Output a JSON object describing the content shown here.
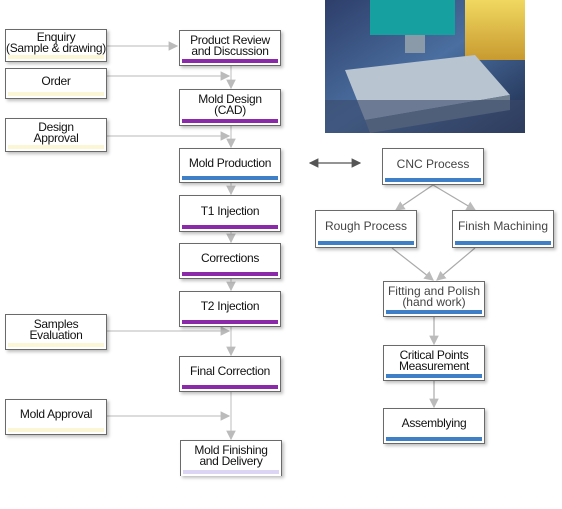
{
  "inputs_column": [
    {
      "id": "enquiry",
      "label_1": "Enquiry",
      "label_2": "(Sample & drawing)"
    },
    {
      "id": "order",
      "label_1": "Order"
    },
    {
      "id": "design-approval",
      "label_1": "Design",
      "label_2": "Approval"
    },
    {
      "id": "samples-evaluation",
      "label_1": "Samples",
      "label_2": "Evaluation"
    },
    {
      "id": "mold-approval",
      "label_1": "Mold Approval"
    }
  ],
  "main_flow": [
    {
      "label_1": "Product Review",
      "label_2": "and Discussion"
    },
    {
      "label_1": "Mold Design",
      "label_2": "(CAD)"
    },
    {
      "label_1": "Mold Production"
    },
    {
      "label_1": "T1 Injection"
    },
    {
      "label_1": "Corrections"
    },
    {
      "label_1": "T2 Injection"
    },
    {
      "label_1": "Final Correction"
    },
    {
      "label_1": "Mold Finishing",
      "label_2": "and Delivery"
    }
  ],
  "cnc_flow": [
    {
      "label_1": "CNC Process"
    },
    {
      "label_1": "Rough Process"
    },
    {
      "label_1": "Finish Machining"
    },
    {
      "label_1": "Fitting and Polish",
      "label_2": "(hand work)"
    },
    {
      "label_1": "Critical Points",
      "label_2": "Measurement"
    },
    {
      "label_1": "Assemblying"
    }
  ],
  "colors": {
    "input_bar": "#fbf6d6",
    "main_bar": "#8a2aa8",
    "cnc_bar": "#3f7fc6",
    "arrow": "#c8c8c8"
  }
}
